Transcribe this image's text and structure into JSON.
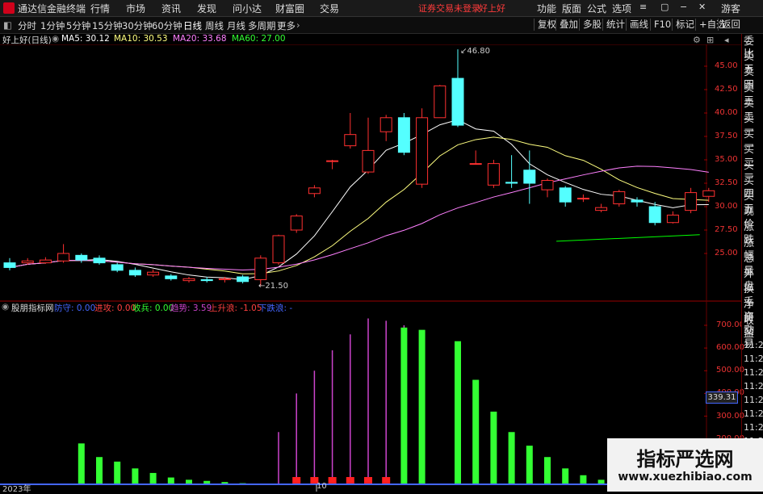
{
  "titlebar": {
    "app_name": "通达信金融终端",
    "menus": [
      "行情",
      "市场",
      "资讯",
      "发现",
      "问小达",
      "财富圈",
      "交易"
    ],
    "login_warning": "证券交易未登录",
    "login_link": "好上好",
    "right_menus": [
      "功能",
      "版面",
      "公式",
      "选项"
    ],
    "guest": "游客"
  },
  "toolbar": {
    "periods": [
      "分时",
      "1分钟",
      "5分钟",
      "15分钟",
      "30分钟",
      "60分钟",
      "日线",
      "周线",
      "月线",
      "多周期",
      "更多"
    ],
    "active_period": "日线",
    "right_buttons": [
      "复权",
      "叠加",
      "多股",
      "统计",
      "画线",
      "F10",
      "标记",
      "+自选",
      "返回"
    ]
  },
  "main_chart": {
    "stock_title": "好上好(日线)",
    "ma5": "MA5: 30.12",
    "ma10": "MA10: 30.53",
    "ma20": "MA20: 33.68",
    "ma60": "MA60: 27.00",
    "high_label": "46.80",
    "low_label": "21.50",
    "y_ticks": [
      "45.00",
      "42.50",
      "40.00",
      "37.50",
      "35.00",
      "32.50",
      "30.00",
      "27.50",
      "25.00"
    ]
  },
  "right_panel": {
    "items": [
      "委比",
      "卖五",
      "卖四",
      "卖三",
      "卖二",
      "卖一",
      "买一",
      "买二",
      "买三",
      "买四",
      "买五",
      "现价",
      "涨跌",
      "涨幅",
      "总量",
      "外盘",
      "换手",
      "净资",
      "收益"
    ],
    "lower_items": [
      "自动",
      "交易",
      "11:28",
      "11:28",
      "11:28",
      "11:28",
      "11:28",
      "11:28",
      "11:28",
      "11:28"
    ]
  },
  "indicator": {
    "name": "股朋指标网",
    "defense": "防守: 0.00",
    "attack": "进攻: 0.00",
    "retreat": "收兵: 0.00",
    "trend": "趋势: 3.59",
    "up_wave": "上升浪: -1.05",
    "down_wave": "下跌浪: -",
    "y_ticks": [
      "700.00",
      "600.00",
      "500.00",
      "400.00",
      "300.00",
      "200.00",
      "100.00"
    ],
    "current_value": "339.31"
  },
  "x_axis": {
    "labels": [
      "2023年",
      "10"
    ]
  },
  "watermark": {
    "line1": "指标严选网",
    "line2": "www.xuezhibiao.com"
  },
  "colors": {
    "up": "#ff3030",
    "down": "#54ffff",
    "ma5": "#ffffff",
    "ma10": "#ffff80",
    "ma20": "#ff80ff",
    "ma60": "#00ff00",
    "bar_green": "#33ff33",
    "bar_purple": "#cc44cc",
    "bar_red": "#ff2020"
  },
  "chart_data": {
    "type": "bar",
    "candles": [
      {
        "o": 24.0,
        "c": 23.5,
        "h": 24.5,
        "l": 23.2
      },
      {
        "o": 24.0,
        "c": 24.2,
        "h": 24.5,
        "l": 23.8
      },
      {
        "o": 24.0,
        "c": 24.3,
        "h": 24.6,
        "l": 23.9
      },
      {
        "o": 24.2,
        "c": 25.0,
        "h": 26.0,
        "l": 24.0
      },
      {
        "o": 24.8,
        "c": 24.3,
        "h": 25.0,
        "l": 24.0
      },
      {
        "o": 24.5,
        "c": 24.0,
        "h": 24.8,
        "l": 23.8
      },
      {
        "o": 23.8,
        "c": 23.2,
        "h": 24.0,
        "l": 23.0
      },
      {
        "o": 23.2,
        "c": 22.7,
        "h": 23.5,
        "l": 22.5
      },
      {
        "o": 22.7,
        "c": 23.0,
        "h": 23.3,
        "l": 22.5
      },
      {
        "o": 22.6,
        "c": 22.3,
        "h": 22.8,
        "l": 22.1
      },
      {
        "o": 22.1,
        "c": 22.3,
        "h": 22.5,
        "l": 21.9
      },
      {
        "o": 22.2,
        "c": 22.1,
        "h": 22.5,
        "l": 21.9
      },
      {
        "o": 22.2,
        "c": 22.3,
        "h": 22.5,
        "l": 21.9
      },
      {
        "o": 22.5,
        "c": 22.0,
        "h": 22.7,
        "l": 21.8
      },
      {
        "o": 22.2,
        "c": 24.5,
        "h": 24.8,
        "l": 21.5
      },
      {
        "o": 24.0,
        "c": 26.9,
        "h": 27.0,
        "l": 23.8
      },
      {
        "o": 27.5,
        "c": 29.0,
        "h": 29.2,
        "l": 27.2
      },
      {
        "o": 31.4,
        "c": 32.0,
        "h": 32.3,
        "l": 31.0
      },
      {
        "o": 34.9,
        "c": 34.9,
        "h": 35.0,
        "l": 34.0
      },
      {
        "o": 36.5,
        "c": 37.7,
        "h": 40.0,
        "l": 36.2
      },
      {
        "o": 33.7,
        "c": 36.0,
        "h": 39.5,
        "l": 33.5
      },
      {
        "o": 38.0,
        "c": 39.5,
        "h": 39.8,
        "l": 37.0
      },
      {
        "o": 39.5,
        "c": 35.8,
        "h": 40.0,
        "l": 35.5
      },
      {
        "o": 32.4,
        "c": 39.5,
        "h": 40.5,
        "l": 32.0
      },
      {
        "o": 39.5,
        "c": 42.9,
        "h": 43.0,
        "l": 39.5
      },
      {
        "o": 43.7,
        "c": 38.7,
        "h": 46.8,
        "l": 38.5
      },
      {
        "o": 34.6,
        "c": 34.6,
        "h": 36.0,
        "l": 34.6
      },
      {
        "o": 32.3,
        "c": 34.6,
        "h": 35.0,
        "l": 32.0
      },
      {
        "o": 32.6,
        "c": 32.5,
        "h": 35.5,
        "l": 32.0
      },
      {
        "o": 33.9,
        "c": 32.5,
        "h": 36.0,
        "l": 30.3
      },
      {
        "o": 31.8,
        "c": 32.8,
        "h": 33.0,
        "l": 31.0
      },
      {
        "o": 32.0,
        "c": 30.5,
        "h": 32.2,
        "l": 30.0
      },
      {
        "o": 30.9,
        "c": 30.9,
        "h": 31.3,
        "l": 30.5
      },
      {
        "o": 29.6,
        "c": 29.9,
        "h": 30.3,
        "l": 29.4
      },
      {
        "o": 30.3,
        "c": 31.6,
        "h": 31.8,
        "l": 30.0
      },
      {
        "o": 30.7,
        "c": 30.5,
        "h": 31.0,
        "l": 30.0
      },
      {
        "o": 30.0,
        "c": 28.3,
        "h": 30.5,
        "l": 28.0
      },
      {
        "o": 28.3,
        "c": 29.1,
        "h": 29.5,
        "l": 28.2
      },
      {
        "o": 29.6,
        "c": 31.5,
        "h": 32.0,
        "l": 29.3
      },
      {
        "o": 31.1,
        "c": 31.7,
        "h": 32.0,
        "l": 30.5
      }
    ],
    "volume_green": [
      0,
      0,
      0,
      0,
      180,
      120,
      100,
      70,
      50,
      30,
      20,
      15,
      10,
      5,
      0,
      0,
      0,
      0,
      0,
      0,
      0,
      0,
      690,
      680,
      0,
      630,
      460,
      320,
      230,
      170,
      120,
      70,
      40,
      20
    ],
    "volume_purple": [
      0,
      0,
      0,
      0,
      0,
      0,
      0,
      0,
      0,
      0,
      0,
      0,
      0,
      0,
      0,
      230,
      400,
      500,
      590,
      660,
      730,
      720,
      700,
      0,
      0,
      0,
      0,
      0,
      0,
      0,
      0,
      0,
      0,
      0
    ]
  }
}
